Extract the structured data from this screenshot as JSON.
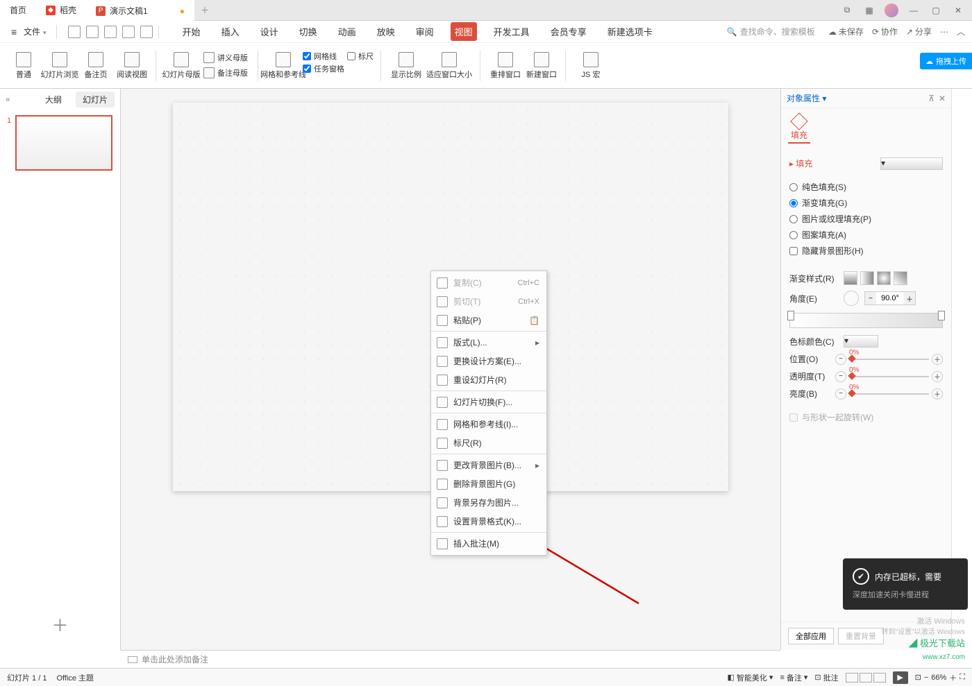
{
  "tabs": {
    "home": "首页",
    "dock": "稻壳",
    "doc": "演示文稿1",
    "modified_dot": "●"
  },
  "menubar": {
    "file": "文件",
    "items": [
      "开始",
      "插入",
      "设计",
      "切换",
      "动画",
      "放映",
      "审阅",
      "视图",
      "开发工具",
      "会员专享",
      "新建选项卡"
    ],
    "activeIndex": 7,
    "search_placeholder": "查找命令、搜索模板",
    "right": {
      "unsaved": "未保存",
      "collab": "协作",
      "share": "分享"
    }
  },
  "ribbon": {
    "normal": "普通",
    "slide_browse": "幻灯片浏览",
    "notes_page": "备注页",
    "reading_view": "阅读视图",
    "slide_master": "幻灯片母版",
    "sort_master": "讲义母版",
    "note_master": "备注母版",
    "grid_guides": "网格和参考线",
    "cb_grid": "网格线",
    "cb_task": "任务窗格",
    "cb_ruler": "标尺",
    "zoom_ratio": "显示比例",
    "fit_window": "适应窗口大小",
    "arrange_win": "重排窗口",
    "new_window": "新建窗口",
    "js_macro": "JS 宏",
    "upload": "拖拽上传"
  },
  "left": {
    "outline": "大纲",
    "slides": "幻灯片",
    "thumb_num": "1"
  },
  "context_menu": {
    "copy": "复制(C)",
    "copy_key": "Ctrl+C",
    "cut": "剪切(T)",
    "cut_key": "Ctrl+X",
    "paste": "粘贴(P)",
    "layout": "版式(L)...",
    "change_design": "更换设计方案(E)...",
    "reset_slide": "重设幻灯片(R)",
    "slide_trans": "幻灯片切换(F)...",
    "grid_guides": "网格和参考线(I)...",
    "ruler": "标尺(R)",
    "change_bg": "更改背景图片(B)...",
    "delete_bg": "删除背景图片(G)",
    "save_bg_as": "背景另存为图片...",
    "bg_format": "设置背景格式(K)...",
    "insert_comment": "插入批注(M)"
  },
  "right_panel": {
    "title": "对象属性",
    "tab_fill": "填充",
    "section_fill": "填充",
    "fill_solid": "纯色填充(S)",
    "fill_gradient": "渐变填充(G)",
    "fill_picture": "图片或纹理填充(P)",
    "fill_pattern": "图案填充(A)",
    "hide_bg_shapes": "隐藏背景图形(H)",
    "grad_style": "渐变样式(R)",
    "angle": "角度(E)",
    "angle_val": "90.0°",
    "stop_color": "色标颜色(C)",
    "position": "位置(O)",
    "position_val": "0%",
    "transparency": "透明度(T)",
    "transparency_val": "0%",
    "brightness": "亮度(B)",
    "brightness_val": "0%",
    "rotate_with_shape": "与形状一起旋转(W)",
    "apply_all": "全部应用",
    "reset_bg": "重置背景"
  },
  "notes_placeholder": "单击此处添加备注",
  "statusbar": {
    "slide_count": "幻灯片 1 / 1",
    "theme": "Office 主题",
    "smart_beautify": "智能美化",
    "notes": "备注",
    "comments": "批注",
    "zoom_val": "66%"
  },
  "notif": {
    "title": "内存已超标，需要",
    "sub": "深度加速关闭卡慢进程"
  },
  "watermark": {
    "activate": "激活 Windows",
    "goto": "转到\"设置\"以激活 Windows",
    "site1": "极光下载站",
    "site2": "www.xz7.com"
  }
}
